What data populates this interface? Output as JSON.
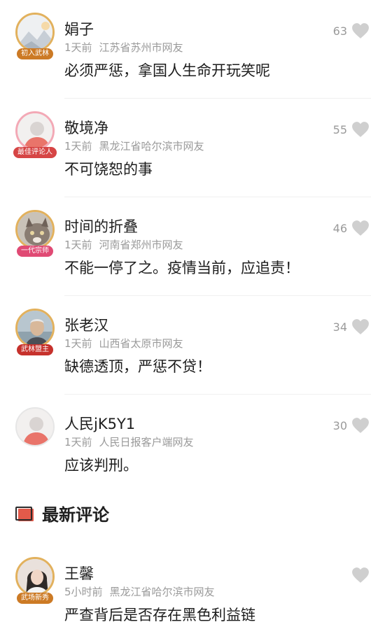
{
  "comments": [
    {
      "name": "娟子",
      "time": "1天前",
      "location": "江苏省苏州市网友",
      "text": "必须严惩，拿国人生命开玩笑呢",
      "likes": "63",
      "badge": "初入武林",
      "avatar": "landscape-avatar"
    },
    {
      "name": "敬境净",
      "time": "1天前",
      "location": "黑龙江省哈尔滨市网友",
      "text": "不可饶恕的事",
      "likes": "55",
      "badge": "最佳评论人",
      "avatar": "default-user-avatar"
    },
    {
      "name": "时间的折叠",
      "time": "1天前",
      "location": "河南省郑州市网友",
      "text": "不能一停了之。疫情当前，应追责！",
      "likes": "46",
      "badge": "一代宗师",
      "avatar": "cat-avatar"
    },
    {
      "name": "张老汉",
      "time": "1天前",
      "location": "山西省太原市网友",
      "text": "缺德透顶，严惩不贷！",
      "likes": "34",
      "badge": "武林盟主",
      "avatar": "elder-portrait-avatar"
    },
    {
      "name": "人民jK5Y1",
      "time": "1天前",
      "location": "人民日报客户端网友",
      "text": "应该判刑。",
      "likes": "30",
      "badge": "",
      "avatar": "default-user-avatar"
    }
  ],
  "section": {
    "title": "最新评论",
    "icon": "comment-icon"
  },
  "latest_comments": [
    {
      "name": "王馨",
      "time": "5小时前",
      "location": "黑龙江省哈尔滨市网友",
      "text": "严查背后是否存在黑色利益链",
      "likes": "",
      "badge": "武场新秀",
      "avatar": "woman-portrait-avatar"
    }
  ],
  "colors": {
    "heart": "#cfcfcf",
    "meta": "#9a9a9a",
    "accent": "#d64545"
  }
}
